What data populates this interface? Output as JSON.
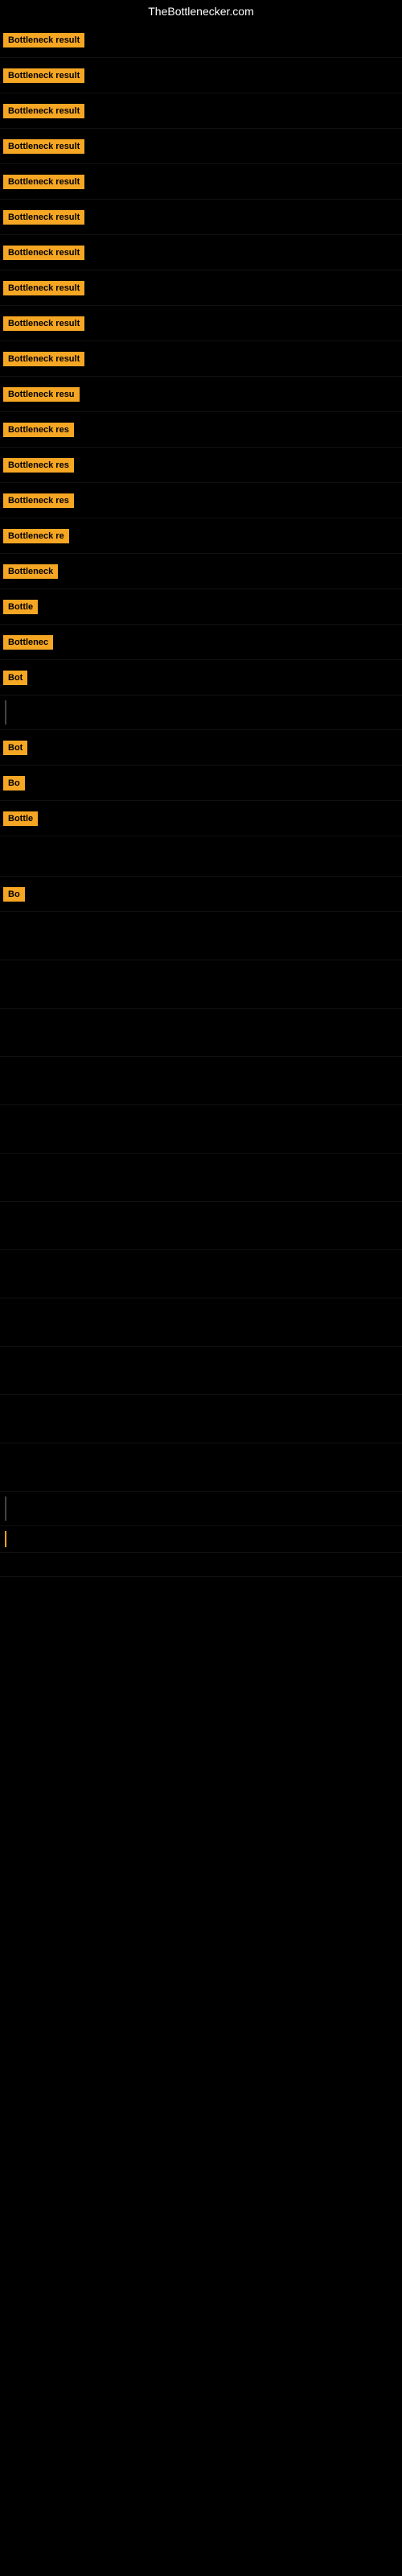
{
  "title": "TheBottlenecker.com",
  "badges": [
    {
      "label": "Bottleneck result",
      "visible": true
    },
    {
      "label": "Bottleneck result",
      "visible": true
    },
    {
      "label": "Bottleneck result",
      "visible": true
    },
    {
      "label": "Bottleneck result",
      "visible": true
    },
    {
      "label": "Bottleneck result",
      "visible": true
    },
    {
      "label": "Bottleneck result",
      "visible": true
    },
    {
      "label": "Bottleneck result",
      "visible": true
    },
    {
      "label": "Bottleneck result",
      "visible": true
    },
    {
      "label": "Bottleneck result",
      "visible": true
    },
    {
      "label": "Bottleneck result",
      "visible": true
    },
    {
      "label": "Bottleneck resu",
      "visible": true
    },
    {
      "label": "Bottleneck res",
      "visible": true
    },
    {
      "label": "Bottleneck res",
      "visible": true
    },
    {
      "label": "Bottleneck res",
      "visible": true
    },
    {
      "label": "Bottleneck re",
      "visible": true
    },
    {
      "label": "Bottleneck",
      "visible": true
    },
    {
      "label": "Bottle",
      "visible": true
    },
    {
      "label": "Bottlenec",
      "visible": true
    },
    {
      "label": "Bot",
      "visible": true
    },
    {
      "label": "",
      "visible": false,
      "line": true
    },
    {
      "label": "Bot",
      "visible": true
    },
    {
      "label": "Bo",
      "visible": true
    },
    {
      "label": "Bottle",
      "visible": true
    },
    {
      "label": "",
      "visible": false
    },
    {
      "label": "Bo",
      "visible": true
    },
    {
      "label": "",
      "visible": false
    },
    {
      "label": "",
      "visible": false
    },
    {
      "label": "",
      "visible": false
    },
    {
      "label": "",
      "visible": false
    },
    {
      "label": "",
      "visible": false
    },
    {
      "label": "",
      "visible": false
    },
    {
      "label": "",
      "visible": false
    },
    {
      "label": "",
      "visible": false
    },
    {
      "label": "",
      "visible": false
    },
    {
      "label": "",
      "visible": false
    },
    {
      "label": "",
      "visible": false
    },
    {
      "label": "",
      "visible": false
    },
    {
      "label": "",
      "visible": false,
      "line": true
    },
    {
      "label": "",
      "visible": false,
      "line2": true
    },
    {
      "label": "",
      "visible": false
    }
  ]
}
